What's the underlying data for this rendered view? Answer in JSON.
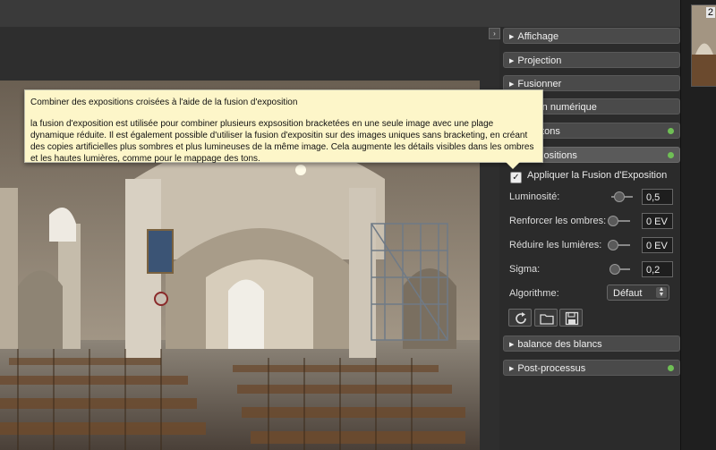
{
  "panel": {
    "collapse_glyph": "›",
    "sections": [
      {
        "label": "Affichage",
        "dot": false
      },
      {
        "label": "Projection",
        "dot": false
      },
      {
        "label": "Fusionner",
        "dot": false
      },
      {
        "label": "ormation numérique",
        "dot": false
      },
      {
        "label": "ge des tons",
        "dot": true
      },
      {
        "label": "des expositions",
        "dot": true
      }
    ],
    "fusion": {
      "apply_label": "Appliquer la Fusion d'Exposition",
      "apply_checked": true,
      "params": [
        {
          "label": "Luminosité:",
          "value": "0,5",
          "level": 0.55
        },
        {
          "label": "Renforcer les ombres:",
          "value": "0 EV",
          "level": 0.0
        },
        {
          "label": "Réduire les lumières:",
          "value": "0 EV",
          "level": 0.0
        },
        {
          "label": "Sigma:",
          "value": "0,2",
          "level": 0.1
        }
      ],
      "algorithm_label": "Algorithme:",
      "algorithm_value": "Défaut",
      "buttons": [
        "reset-icon",
        "open-folder-icon",
        "save-icon"
      ]
    },
    "lower_sections": [
      {
        "label": "balance des blancs",
        "dot": false
      },
      {
        "label": "Post-processus",
        "dot": true
      }
    ]
  },
  "tooltip": {
    "title": "Combiner des expositions croisées à l'aide de la fusion d'exposition",
    "body": "la fusion d'exposition est utilisée pour combiner plusieurs expsosition bracketées en une seule image avec une plage dynamique réduite. Il est également possible d'utiliser la fusion d'expositin sur des images uniques sans bracketing, en créant des copies artificielles plus sombres et plus lumineuses de la même image. Cela augmente les détails visibles dans les ombres et les hautes lumières, comme pour le mappage des tons."
  },
  "thumbnail": {
    "number": "2"
  },
  "colors": {
    "status_dot": "#6fbf55",
    "tooltip_bg": "#fdf6c9"
  }
}
